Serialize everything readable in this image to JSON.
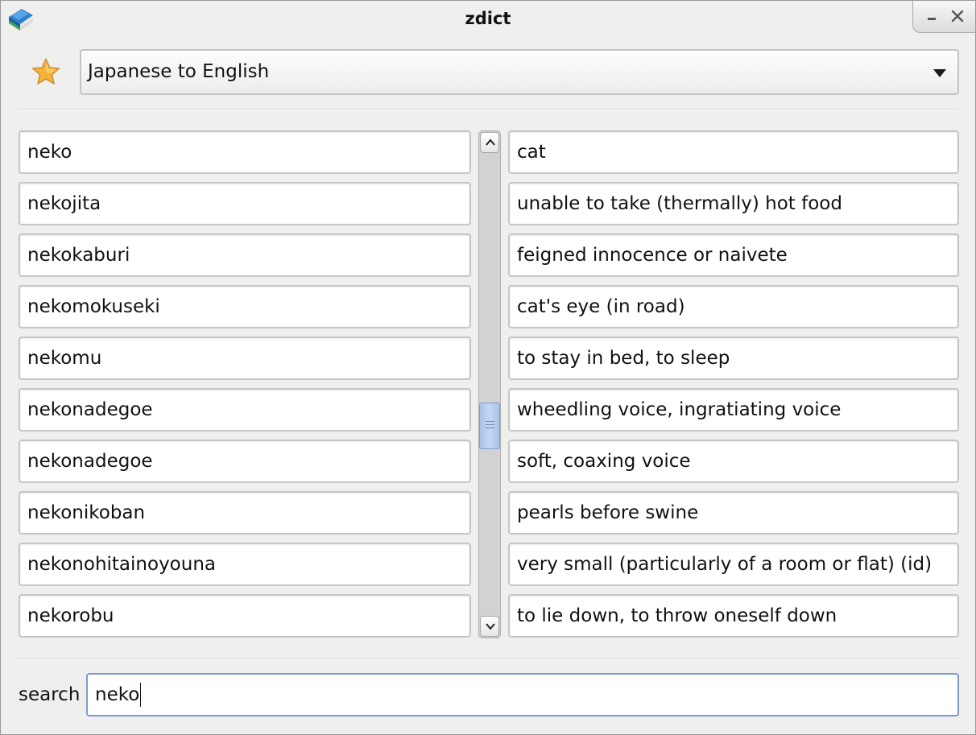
{
  "window": {
    "title": "zdict",
    "controls": [
      "minimize-icon",
      "close-icon"
    ]
  },
  "toolbar": {
    "favorite_icon": "star-icon",
    "dictionary_select": "Japanese to English"
  },
  "results": {
    "words": [
      "neko",
      "nekojita",
      "nekokaburi",
      "nekomokuseki",
      "nekomu",
      "nekonadegoe",
      "nekonadegoe",
      "nekonikoban",
      "nekonohitainoyouna",
      "nekorobu"
    ],
    "meanings": [
      "cat",
      "unable to take (thermally) hot food",
      "feigned innocence or naivete",
      "cat's eye (in road)",
      "to stay in bed, to sleep",
      "wheedling voice, ingratiating voice",
      "soft, coaxing voice",
      "pearls before swine",
      "very small (particularly of a room or flat) (id)",
      "to lie down, to throw oneself down"
    ]
  },
  "search": {
    "label": "search",
    "value": "neko"
  },
  "colors": {
    "window_bg": "#efefee",
    "accent_focus": "#7d9ad2",
    "scroll_thumb": "#b7cdee",
    "star": "#f3b23a"
  }
}
